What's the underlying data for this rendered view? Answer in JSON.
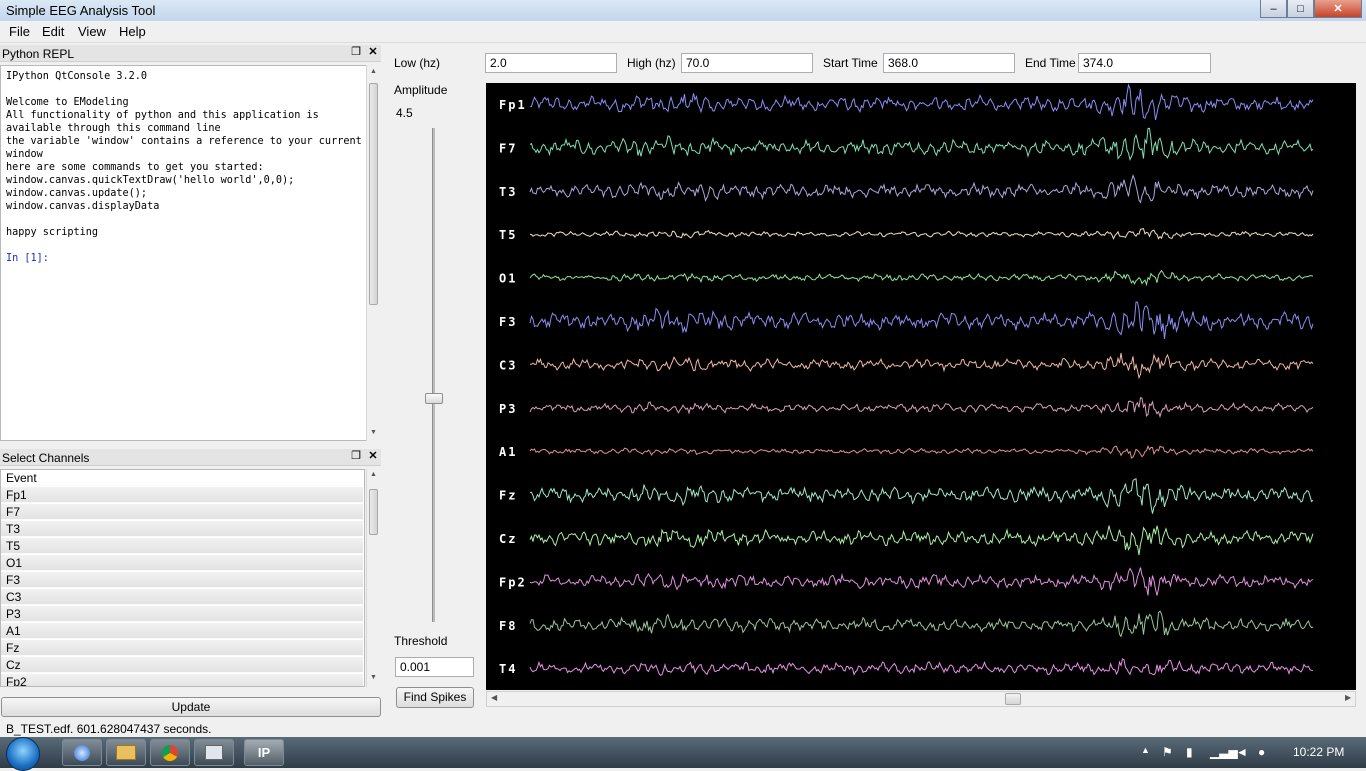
{
  "window": {
    "title": "Simple EEG Analysis Tool",
    "controls": {
      "minimize": "–",
      "maximize": "□",
      "close": "✕"
    }
  },
  "menu": [
    "File",
    "Edit",
    "View",
    "Help"
  ],
  "repl_panel": {
    "title": "Python REPL",
    "lines": [
      "IPython QtConsole 3.2.0",
      "",
      "Welcome to EModeling",
      "All functionality of python and this application is",
      "available through this command line",
      "the variable 'window' contains a reference to your current",
      "window",
      "here are some commands to get you started:",
      "window.canvas.quickTextDraw('hello world',0,0);",
      "window.canvas.update();",
      "window.canvas.displayData",
      "",
      "happy scripting",
      "",
      "In [1]:"
    ]
  },
  "channels_panel": {
    "title": "Select Channels",
    "items": [
      "Event",
      "Fp1",
      "F7",
      "T3",
      "T5",
      "O1",
      "F3",
      "C3",
      "P3",
      "A1",
      "Fz",
      "Cz",
      "Fp2"
    ],
    "update_label": "Update"
  },
  "controls": {
    "low_label": "Low (hz)",
    "low_value": "2.0",
    "high_label": "High (hz)",
    "high_value": "70.0",
    "start_label": "Start Time",
    "start_value": "368.0",
    "end_label": "End Time",
    "end_value": "374.0",
    "amplitude_label": "Amplitude",
    "amplitude_value": "4.5",
    "threshold_label": "Threshold",
    "threshold_value": "0.001",
    "find_spikes_label": "Find Spikes"
  },
  "eeg": {
    "traces": [
      {
        "label": "Fp1",
        "color": "#8a8cf0",
        "amp": 1.0
      },
      {
        "label": "F7",
        "color": "#7ee0b0",
        "amp": 1.0
      },
      {
        "label": "T3",
        "color": "#a8a8dc",
        "amp": 0.9
      },
      {
        "label": "T5",
        "color": "#f0e0b8",
        "amp": 0.35
      },
      {
        "label": "O1",
        "color": "#8ee890",
        "amp": 0.45
      },
      {
        "label": "F3",
        "color": "#8a8cf0",
        "amp": 1.1
      },
      {
        "label": "C3",
        "color": "#f0b8a0",
        "amp": 0.75
      },
      {
        "label": "P3",
        "color": "#d8a0b8",
        "amp": 0.55
      },
      {
        "label": "A1",
        "color": "#e09090",
        "amp": 0.35
      },
      {
        "label": "Fz",
        "color": "#9ce8c8",
        "amp": 1.0
      },
      {
        "label": "Cz",
        "color": "#a8f0a0",
        "amp": 0.95
      },
      {
        "label": "Fp2",
        "color": "#e090e0",
        "amp": 0.85
      },
      {
        "label": "F8",
        "color": "#98c898",
        "amp": 0.9
      },
      {
        "label": "T4",
        "color": "#e890e8",
        "amp": 0.75
      }
    ]
  },
  "status": {
    "text": "B_TEST.edf.  601.628047437 seconds."
  },
  "taskbar": {
    "clock": "10:22 PM",
    "active_app_label": "IP"
  }
}
